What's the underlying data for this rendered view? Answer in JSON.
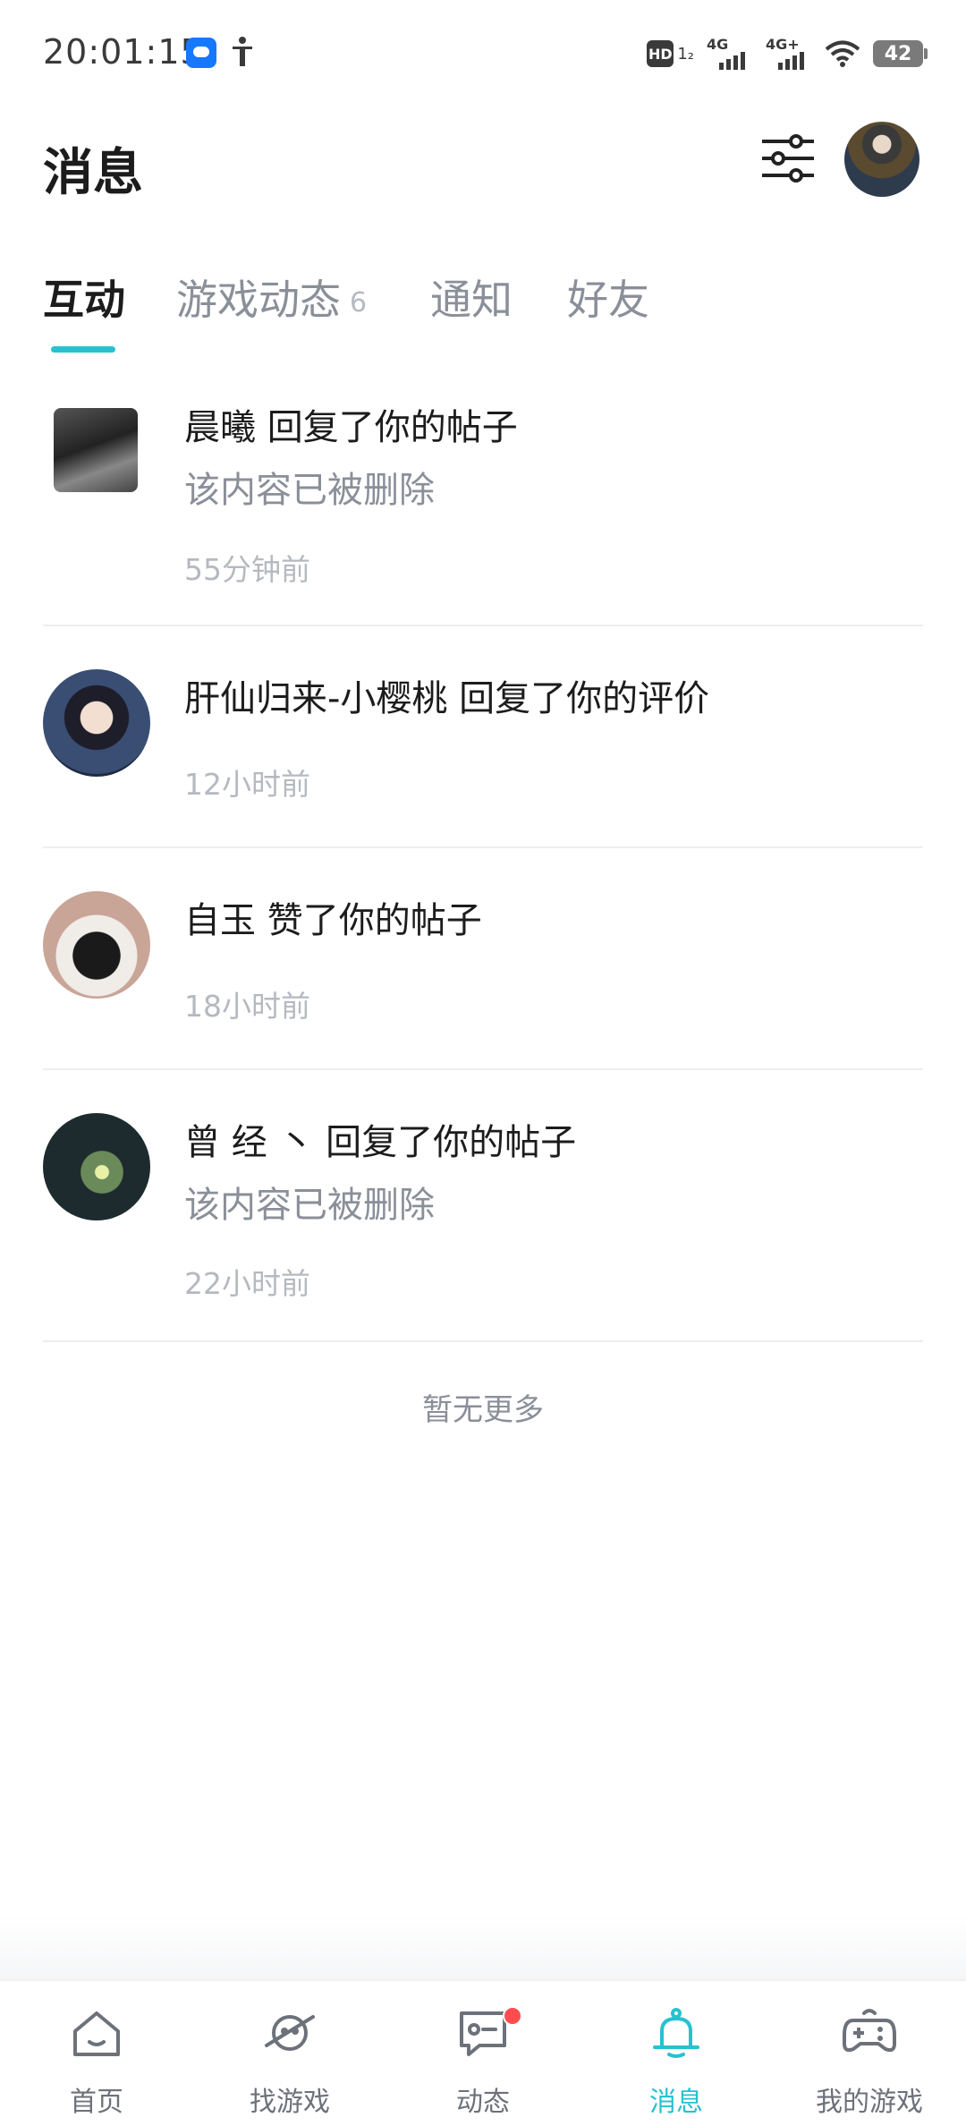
{
  "status_bar": {
    "time": "20:01:15",
    "hd_label": "HD",
    "hd_sup": "1₂",
    "net1": "4G",
    "net2": "4G+",
    "battery": "42"
  },
  "header": {
    "title": "消息",
    "filter_icon": "sliders-icon",
    "avatar_icon": "user-avatar"
  },
  "tabs": [
    {
      "label": "互动",
      "active": true
    },
    {
      "label": "游戏动态",
      "count": "6"
    },
    {
      "label": "通知"
    },
    {
      "label": "好友"
    }
  ],
  "messages": [
    {
      "title": "晨曦 回复了你的帖子",
      "content": "该内容已被删除",
      "time": "55分钟前"
    },
    {
      "title": "肝仙归来-小樱桃 回复了你的评价",
      "content": "",
      "time": "12小时前"
    },
    {
      "title": "自玉 赞了你的帖子",
      "content": "",
      "time": "18小时前"
    },
    {
      "title": "曾 经 丶 回复了你的帖子",
      "content": "该内容已被删除",
      "time": "22小时前"
    }
  ],
  "end_text": "暂无更多",
  "bottom_nav": [
    {
      "label": "首页",
      "icon": "home-icon"
    },
    {
      "label": "找游戏",
      "icon": "planet-icon"
    },
    {
      "label": "动态",
      "icon": "chat-icon",
      "badge": true
    },
    {
      "label": "消息",
      "icon": "bell-icon",
      "active": true
    },
    {
      "label": "我的游戏",
      "icon": "gamepad-icon"
    }
  ],
  "colors": {
    "accent": "#27c2cf",
    "badge": "#ff4d4f",
    "text_primary": "#1c1c1c",
    "text_secondary": "#8a8f99",
    "text_tertiary": "#b5b9c0"
  }
}
